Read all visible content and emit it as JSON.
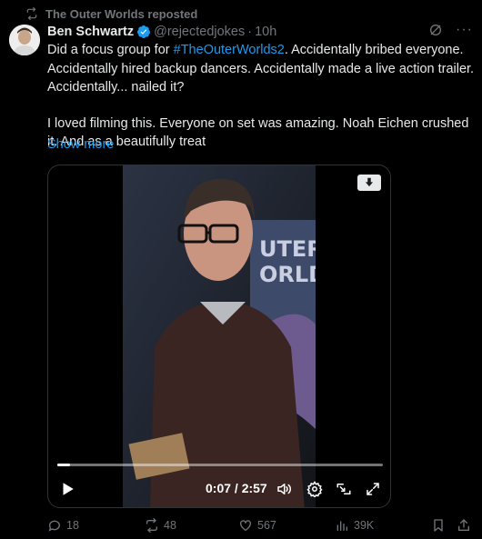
{
  "repost": {
    "label": "The Outer Worlds reposted",
    "icon": "repost-icon"
  },
  "author": {
    "name": "Ben Schwartz",
    "handle": "@rejectedjokes",
    "separator": "·",
    "time": "10h",
    "verified": true
  },
  "tweet": {
    "line1_prefix": "Did a focus group for ",
    "hashtag": "#TheOuterWorlds2",
    "line1_suffix": ". Accidentally bribed everyone. Accidentally hired backup dancers. Accidentally made a live action trailer. Accidentally... nailed it?",
    "paragraph2": "I loved filming this. Everyone on set was amazing. Noah Eichen crushed it. And as a beautifully treat",
    "show_more": "Show more"
  },
  "video": {
    "time_display": "0:07 / 2:57",
    "progress": 0.04
  },
  "actions": {
    "replies": "18",
    "reposts": "48",
    "likes": "567",
    "views": "39K"
  },
  "colors": {
    "accent": "#1d9bf0",
    "muted": "#71767b",
    "text": "#e7e9ea",
    "background": "#000000"
  }
}
